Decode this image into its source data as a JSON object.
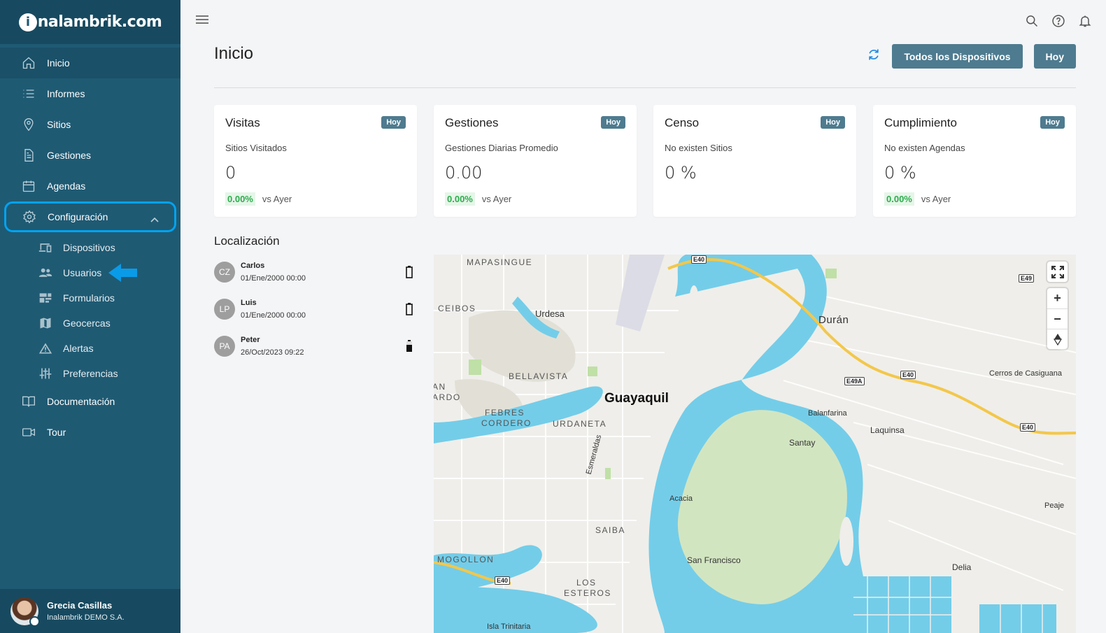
{
  "brand": {
    "logo_i": "i",
    "logo_rest": "nalambrik.com"
  },
  "sidebar": {
    "items": [
      {
        "label": "Inicio",
        "icon": "home-icon"
      },
      {
        "label": "Informes",
        "icon": "list-icon"
      },
      {
        "label": "Sitios",
        "icon": "location-pin-icon"
      },
      {
        "label": "Gestiones",
        "icon": "document-icon"
      },
      {
        "label": "Agendas",
        "icon": "calendar-icon"
      },
      {
        "label": "Configuración",
        "icon": "gear-icon"
      },
      {
        "label": "Documentación",
        "icon": "book-icon"
      },
      {
        "label": "Tour",
        "icon": "video-camera-icon"
      }
    ],
    "config_sub": [
      {
        "label": "Dispositivos",
        "icon": "devices-icon"
      },
      {
        "label": "Usuarios",
        "icon": "users-icon"
      },
      {
        "label": "Formularios",
        "icon": "forms-icon"
      },
      {
        "label": "Geocercas",
        "icon": "map-icon"
      },
      {
        "label": "Alertas",
        "icon": "warning-icon"
      },
      {
        "label": "Preferencias",
        "icon": "sliders-icon"
      }
    ],
    "user": {
      "name": "Grecia Casillas",
      "org": "Inalambrik DEMO S.A."
    }
  },
  "header": {
    "title": "Inicio",
    "devices_button": "Todos los Dispositivos",
    "today_button": "Hoy"
  },
  "cards": [
    {
      "title": "Visitas",
      "badge": "Hoy",
      "subtitle": "Sitios Visitados",
      "value": "0",
      "pct": "0.00%",
      "vs": "vs Ayer"
    },
    {
      "title": "Gestiones",
      "badge": "Hoy",
      "subtitle": "Gestiones Diarias Promedio",
      "value": "0.00",
      "pct": "0.00%",
      "vs": "vs Ayer"
    },
    {
      "title": "Censo",
      "badge": "Hoy",
      "subtitle": "No existen Sitios",
      "value": "0 %",
      "pct": "",
      "vs": ""
    },
    {
      "title": "Cumplimiento",
      "badge": "Hoy",
      "subtitle": "No existen Agendas",
      "value": "0 %",
      "pct": "0.00%",
      "vs": "vs Ayer"
    }
  ],
  "location": {
    "title": "Localización",
    "devices": [
      {
        "initials": "CZ",
        "name": "Carlos",
        "time": "01/Ene/2000 00:00",
        "battery": "full"
      },
      {
        "initials": "LP",
        "name": "Luis",
        "time": "01/Ene/2000 00:00",
        "battery": "full"
      },
      {
        "initials": "PA",
        "name": "Peter",
        "time": "26/Oct/2023 09:22",
        "battery": "low"
      }
    ]
  },
  "map": {
    "labels": {
      "mapasingue": "MAPASINGUE",
      "ceibos": "CEIBOS",
      "urdesa": "Urdesa",
      "bellavista": "BELLAVISTA",
      "guayaquil": "Guayaquil",
      "febres": "FEBRES",
      "cordero": "CORDERO",
      "urdaneta": "URDANETA",
      "esmeraldas": "Esmeraldas",
      "saiba": "SAIBA",
      "mogollon": "MOGOLLON",
      "los": "LOS",
      "esteros": "ESTEROS",
      "trinitaria": "Isla Trinitaria",
      "duran": "Durán",
      "cerros": "Cerros de Casiguana",
      "balanfarina": "Balanfarina",
      "laquinsa": "Laquinsa",
      "santay": "Santay",
      "acacia": "Acacia",
      "sanfrancisco": "San Francisco",
      "delia": "Delia",
      "peaje": "Peaje",
      "san_cut": "AN",
      "nardo_cut": "ARDO"
    },
    "shields": {
      "e40_top": "E40",
      "e49": "E49",
      "e49a": "E49A",
      "e40_mid": "E40",
      "e40_right": "E40",
      "e40_bottom": "E40"
    },
    "controls": {
      "zoom_in": "+",
      "zoom_out": "−"
    }
  }
}
